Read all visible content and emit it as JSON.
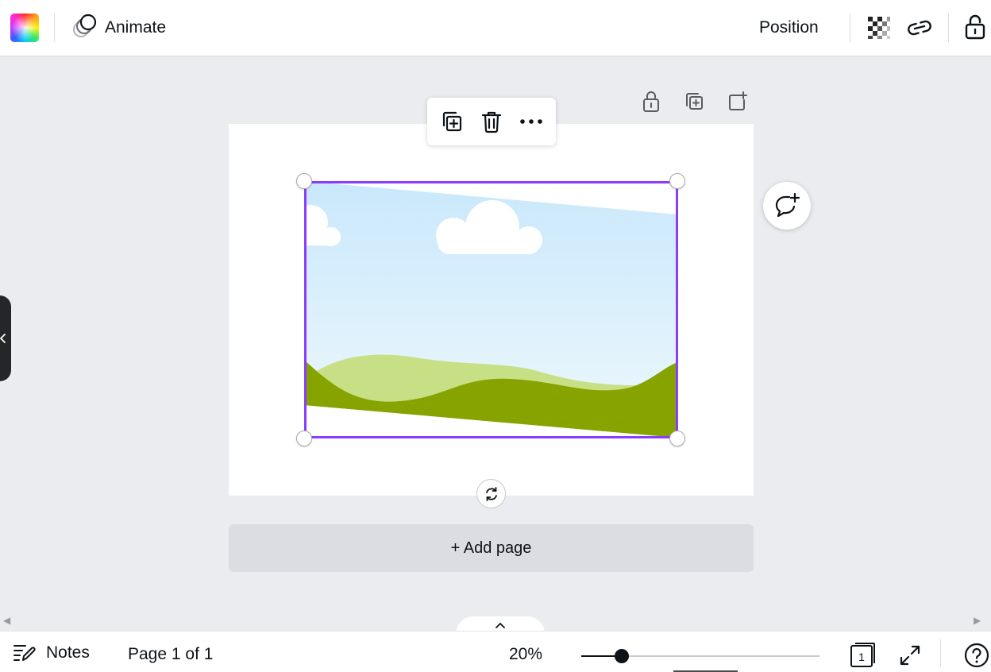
{
  "toolbar": {
    "color_swatch": "color-picker",
    "animate_label": "Animate",
    "position_label": "Position",
    "icons": [
      "transparency-icon",
      "link-icon",
      "lock-icon"
    ]
  },
  "canvas": {
    "page_tools": [
      "unlock-icon",
      "duplicate-page-icon",
      "add-page-icon"
    ],
    "element_toolbar": [
      "duplicate-icon",
      "trash-icon",
      "more-icon"
    ],
    "selection_color": "#8b3dff",
    "image": {
      "sky_top": "#c9e8fb",
      "sky_bottom": "#eef8fd",
      "hill_light": "#c7e085",
      "hill_dark": "#87a300"
    },
    "add_page_label": "+ Add page"
  },
  "bottom": {
    "notes_label": "Notes",
    "page_indicator": "Page 1 of 1",
    "zoom_label": "20%",
    "zoom_fraction": 0.17,
    "page_count_badge": "1"
  }
}
